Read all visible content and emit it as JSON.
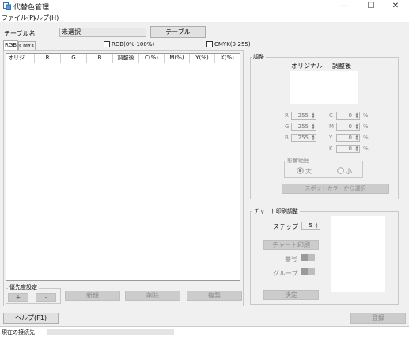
{
  "window": {
    "title": "代替色管理",
    "controls": {
      "minimize": "—",
      "maximize": "☐",
      "close": "✕"
    }
  },
  "menu": [
    {
      "label": "ファイル(F)"
    },
    {
      "label": "ヘルプ(H)"
    }
  ],
  "table_name": {
    "label": "テーブル名",
    "value": "未選択",
    "button": "テーブル"
  },
  "tabs": [
    {
      "label": "RGB",
      "active": true
    },
    {
      "label": "CMYK",
      "active": false
    }
  ],
  "checkboxes": {
    "rgb_percent": {
      "label": "RGB(0%-100%)",
      "checked": false
    },
    "cmyk_range": {
      "label": "CMYK(0-255)",
      "checked": false
    }
  },
  "grid": {
    "columns": [
      "オリジ...",
      "R",
      "G",
      "B",
      "調整後",
      "C(%)",
      "M(%)",
      "Y(%)",
      "K(%)"
    ]
  },
  "priority": {
    "legend": "優先度設定",
    "up": "+",
    "down": "-"
  },
  "actions": {
    "new": "新規",
    "delete": "削除",
    "copy": "複製"
  },
  "adjust": {
    "legend": "調整",
    "original_label": "オリジナル",
    "adjusted_label": "調整後",
    "rgb": [
      {
        "label": "R",
        "value": "255"
      },
      {
        "label": "G",
        "value": "255"
      },
      {
        "label": "B",
        "value": "255"
      }
    ],
    "cmyk": [
      {
        "label": "C",
        "value": "0",
        "unit": "%"
      },
      {
        "label": "M",
        "value": "0",
        "unit": "%"
      },
      {
        "label": "Y",
        "value": "0",
        "unit": "%"
      },
      {
        "label": "K",
        "value": "0",
        "unit": "%"
      }
    ],
    "range": {
      "legend": "影響範囲",
      "large": "大",
      "small": "小",
      "selected": "大"
    },
    "spot_button": "スポットカラーから選択"
  },
  "chart": {
    "legend": "チャート印刷調整",
    "step_label": "ステップ",
    "step_value": "5",
    "print_button": "チャート印刷",
    "number_label": "番号",
    "group_label": "グループ",
    "confirm_button": "決定"
  },
  "footer": {
    "help_button": "ヘルプ(F1)",
    "register_button": "登録",
    "status_label": "現在の接続先"
  }
}
